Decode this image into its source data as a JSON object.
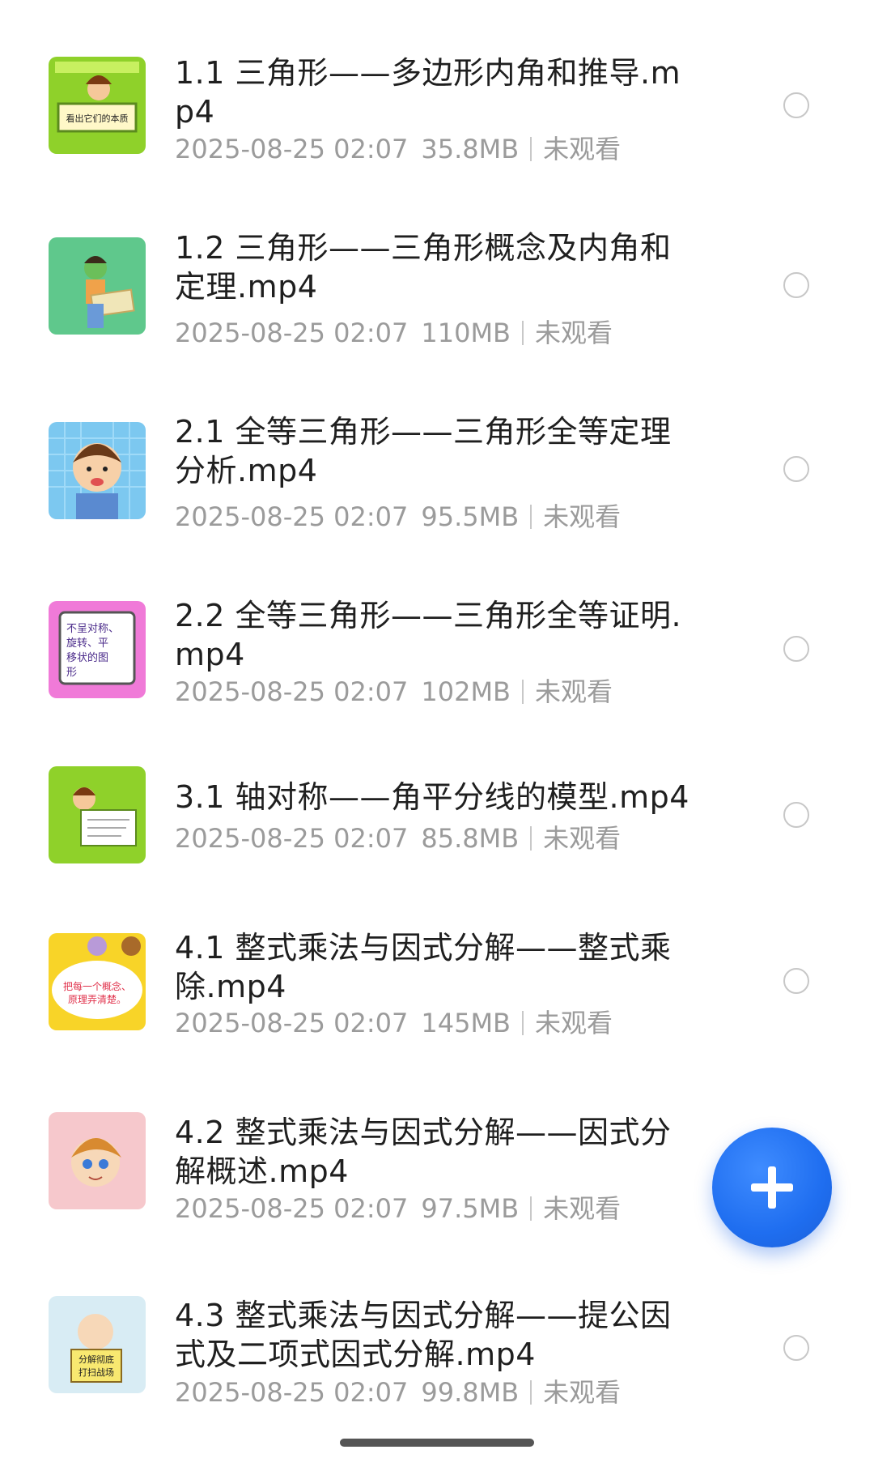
{
  "items": [
    {
      "title": "1.1 三角形——多边形内角和推导.mp4",
      "date": "2025-08-25 02:07",
      "size": "35.8MB",
      "status": "未观看",
      "thumb_text": "看出它们的本质",
      "thumb_color": "#8fd12a"
    },
    {
      "title": "1.2 三角形——三角形概念及内角和定理.mp4",
      "date": "2025-08-25 02:07",
      "size": "110MB",
      "status": "未观看",
      "thumb_text": "",
      "thumb_color": "#5fc88c"
    },
    {
      "title": "2.1 全等三角形——三角形全等定理分析.mp4",
      "date": "2025-08-25 02:07",
      "size": "95.5MB",
      "status": "未观看",
      "thumb_text": "",
      "thumb_color": "#7cc8f0"
    },
    {
      "title": "2.2 全等三角形——三角形全等证明.mp4",
      "date": "2025-08-25 02:07",
      "size": "102MB",
      "status": "未观看",
      "thumb_text": "不呈对称、旋转、平移状的图形",
      "thumb_color": "#f07ad8"
    },
    {
      "title": "3.1 轴对称——角平分线的模型.mp4",
      "date": "2025-08-25 02:07",
      "size": "85.8MB",
      "status": "未观看",
      "thumb_text": "",
      "thumb_color": "#8fd12a"
    },
    {
      "title": "4.1 整式乘法与因式分解——整式乘除.mp4",
      "date": "2025-08-25 02:07",
      "size": "145MB",
      "status": "未观看",
      "thumb_text": "把每一个概念、原理弄清楚。",
      "thumb_color": "#f8d428"
    },
    {
      "title": "4.2 整式乘法与因式分解——因式分解概述.mp4",
      "date": "2025-08-25 02:07",
      "size": "97.5MB",
      "status": "未观看",
      "thumb_text": "",
      "thumb_color": "#f6c8cc"
    },
    {
      "title": "4.3 整式乘法与因式分解——提公因式及二项式因式分解.mp4",
      "date": "2025-08-25 02:07",
      "size": "99.8MB",
      "status": "未观看",
      "thumb_text": "分解彻底打扫战场",
      "thumb_color": "#d8ecf4"
    }
  ],
  "fab": {
    "icon": "plus-icon",
    "color": "#1f6ef0"
  }
}
